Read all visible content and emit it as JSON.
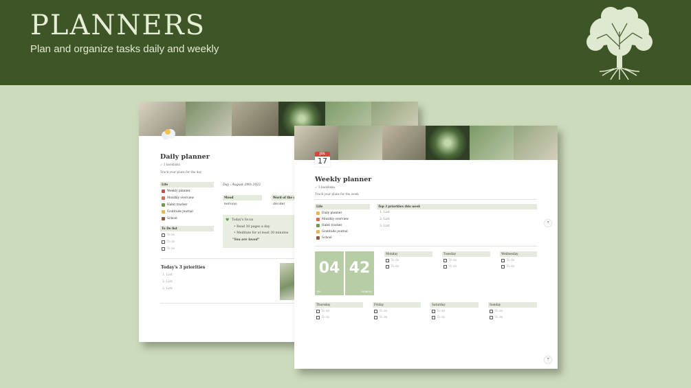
{
  "header": {
    "title": "PLANNERS",
    "subtitle": "Plan and organize tasks daily and weekly"
  },
  "daily": {
    "title": "Daily planner",
    "backlinks": "↙ 3 backlinks",
    "description": "Track your plans for the day",
    "day_line": "Day : August 29th 2022",
    "life_header": "Life",
    "life_items": [
      "Weekly planner",
      "Monthly overview",
      "Habit tracker",
      "Gratitude journal",
      "School"
    ],
    "todo_header": "To Do list",
    "todos": [
      "To do",
      "To do",
      "To do"
    ],
    "mood_header": "Mood",
    "mood_value": "nervous",
    "word_header": "Word of the day",
    "word_value": "décider",
    "focus": {
      "title": "Today's focus",
      "items": [
        "Read 30 pages a day",
        "Meditate for at least 30 minutes"
      ],
      "quote": "\"You are loved\""
    },
    "priorities_title": "Today's 3 priorities",
    "priorities": [
      "List",
      "List",
      "List"
    ]
  },
  "weekly": {
    "title": "Weekly planner",
    "backlinks": "↙ 3 backlinks",
    "description": "Track your plans for the week",
    "calendar": {
      "month": "JUL",
      "day": "17"
    },
    "life_header": "Life",
    "life_items": [
      "Daily planner",
      "Monthly overview",
      "Habit tracker",
      "Gratitude journal",
      "School"
    ],
    "top_header": "Top 3 priorities this week",
    "top_items": [
      "List",
      "List",
      "List"
    ],
    "clock": {
      "hours": "04",
      "minutes": "42",
      "ampm": "PM",
      "weekday": "MONDAY"
    },
    "days_row1": [
      {
        "name": "Monday",
        "todos": [
          "To do",
          "To do"
        ]
      },
      {
        "name": "Tuesday",
        "todos": [
          "To do",
          "To do"
        ]
      },
      {
        "name": "Wednesday",
        "todos": [
          "To do",
          "To do"
        ]
      }
    ],
    "days_row2": [
      {
        "name": "Thursday",
        "todos": [
          "To do",
          "To do"
        ]
      },
      {
        "name": "Friday",
        "todos": [
          "To do",
          "To do"
        ]
      },
      {
        "name": "Saturday",
        "todos": [
          "To do",
          "To do"
        ]
      },
      {
        "name": "Sunday",
        "todos": [
          "To do",
          "To do"
        ]
      }
    ],
    "help": "?"
  },
  "icons": {
    "tree": "tree-logo-icon",
    "cloud": "cloud-icon",
    "calendar": "calendar-icon",
    "heart": "green-heart-icon"
  },
  "colors": {
    "header_bg": "#3e5528",
    "page_bg": "#cddbbd",
    "title_text": "#e6efd6",
    "accent_green": "#b7cda6",
    "table_header": "#e4ebdc"
  }
}
